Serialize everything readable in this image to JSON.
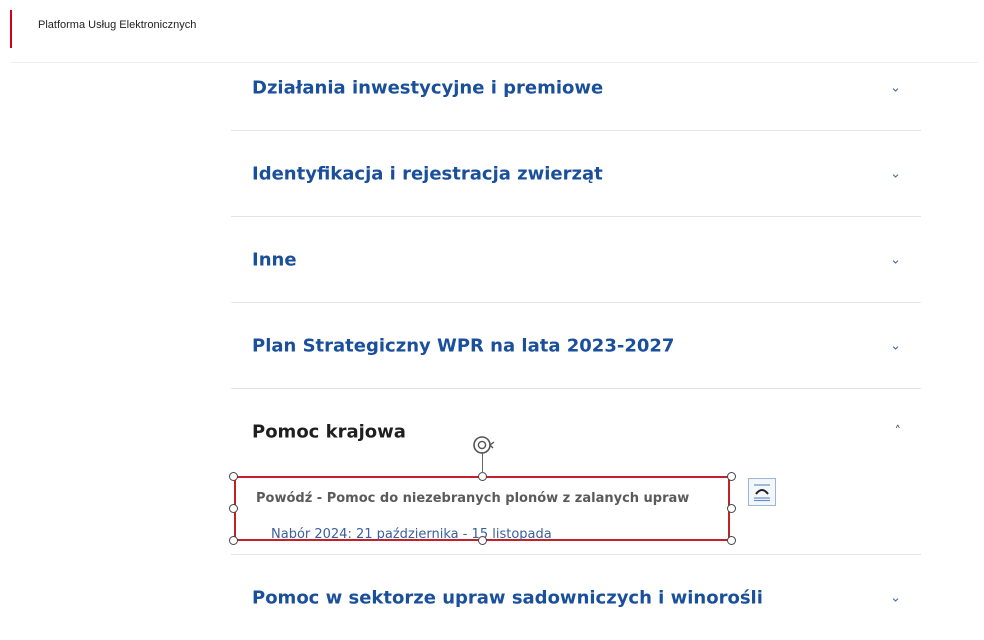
{
  "header": {
    "brand": "Platforma Usług Elektronicznych"
  },
  "accordion": {
    "items": [
      {
        "title": "Działania inwestycyjne i premiowe",
        "icon": "chevron-down-icon"
      },
      {
        "title": "Identyfikacja i rejestracja zwierząt",
        "icon": "chevron-down-icon"
      },
      {
        "title": "Inne",
        "icon": "chevron-down-icon"
      },
      {
        "title": "Plan Strategiczny WPR na lata 2023-2027",
        "icon": "chevron-down-icon"
      },
      {
        "title": "Pomoc krajowa",
        "icon": "chevron-up-icon"
      },
      {
        "title": "Pomoc w sektorze upraw sadowniczych i winorośli",
        "icon": "chevron-down-icon"
      }
    ],
    "expanded": {
      "subtitle": "Powódź - Pomoc do niezebranych plonów z zalanych upraw",
      "link": "Nabór 2024: 21 października - 15 listopada"
    }
  },
  "colors": {
    "accent": "#1a4f9c",
    "selection": "#c41f2a",
    "brand_bar": "#d0021b"
  },
  "chevrons": {
    "down": "⌄",
    "up": "˄"
  }
}
